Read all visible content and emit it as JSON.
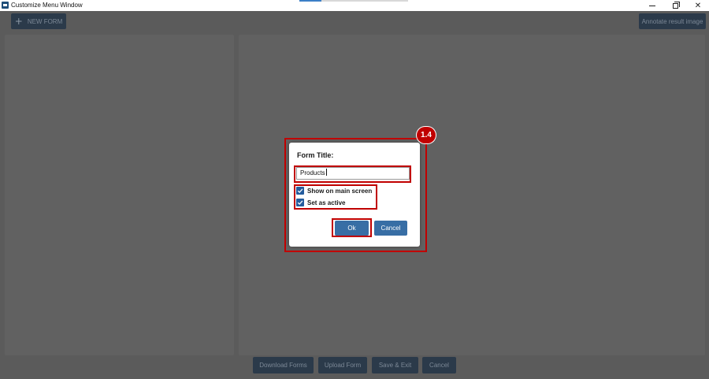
{
  "window": {
    "title": "Customize Menu Window",
    "icons": {
      "app": "app-logo-icon",
      "minimize": "minimize-icon",
      "maximize": "restore-icon",
      "close": "close-icon"
    },
    "close_glyph": "✕"
  },
  "toolbar": {
    "new_form_label": "NEW FORM",
    "new_form_icon": "plus-icon",
    "annotate_label": "Annotate result image"
  },
  "footer": {
    "download_label": "Download Forms",
    "upload_label": "Upload Form",
    "save_exit_label": "Save & Exit",
    "cancel_label": "Cancel"
  },
  "dialog": {
    "form_title_label": "Form Title:",
    "form_title_value": "Products",
    "checkboxes": [
      {
        "label": "Show on main screen",
        "checked": true
      },
      {
        "label": "Set as active",
        "checked": true
      }
    ],
    "ok_label": "Ok",
    "cancel_label": "Cancel"
  },
  "annotation": {
    "step_badge": "1.4",
    "highlight_color": "#c00000"
  },
  "colors": {
    "button_primary": "#386ea5",
    "checkbox": "#245c9e",
    "overlay_background": "#5b5b5b"
  }
}
